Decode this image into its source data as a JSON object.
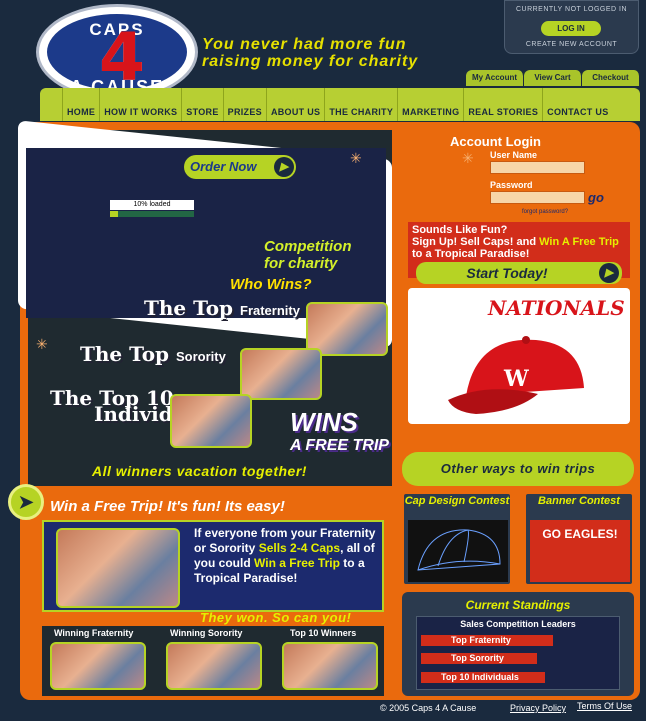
{
  "logo": {
    "top": "CAPS",
    "number": "4",
    "bottom": "A CAUSE"
  },
  "tagline": {
    "line1": "You never had more fun",
    "line2": "raising money for charity"
  },
  "login_box": {
    "status": "CURRENTLY NOT LOGGED IN",
    "button": "LOG IN",
    "create": "CREATE NEW ACCOUNT"
  },
  "utility": [
    "My Account",
    "View Cart",
    "Checkout"
  ],
  "nav": [
    "HOME",
    "HOW IT WORKS",
    "STORE",
    "PRIZES",
    "ABOUT US",
    "THE CHARITY",
    "MARKETING",
    "REAL STORIES",
    "CONTACT US"
  ],
  "flash": {
    "order_now": "Order Now",
    "loaded": "10% loaded",
    "loaded_fraction": 0.1
  },
  "competition": {
    "title_line1": "Competition",
    "title_line2": "for charity",
    "who_wins": "Who Wins?",
    "fraternity": {
      "prefix": "The Top",
      "word": "Fraternity"
    },
    "sorority": {
      "prefix": "The Top",
      "word": "Sorority"
    },
    "individuals": {
      "prefix": "The Top 10",
      "word": "Individuals"
    },
    "wins": "WINS",
    "free_trip": "A FREE TRIP",
    "all_winners": "All winners vacation together!"
  },
  "free_trip": {
    "heading": "Win a Free Trip! It's fun! Its easy!",
    "text_a": "If everyone from your Fraternity or Sorority",
    "text_hl1": "Sells 2-4 Caps",
    "text_b": ", all of you could",
    "text_hl2": "Win a Free Trip",
    "text_c": "to a Tropical Paradise!",
    "they_won": "They won. So can you!"
  },
  "winners": [
    "Winning Fraternity",
    "Winning Sorority",
    "Top 10 Winners"
  ],
  "account": {
    "title": "Account Login",
    "username_label": "User Name",
    "password_label": "Password",
    "go": "go",
    "forgot": "forgot password?"
  },
  "signup": {
    "line1": "Sounds Like Fun?",
    "line2a": "Sign Up! Sell Caps! and",
    "line2hl": "Win A Free Trip",
    "line2b": "to a Tropical Paradise!",
    "start": "Start Today!",
    "cap_brand": "NATIONALS"
  },
  "other_ways": "Other ways to win trips",
  "contests": {
    "cap_design": "Cap Design Contest",
    "banner": "Banner Contest",
    "banner_sign": "GO EAGLES!"
  },
  "standings": {
    "title": "Current Standings",
    "subtitle": "Sales Competition Leaders",
    "rows": [
      "Top Fraternity",
      "Top Sorority",
      "Top 10 Individuals"
    ]
  },
  "footer": {
    "copyright": "© 2005 Caps 4 A Cause",
    "privacy": "Privacy Policy",
    "terms": "Terms Of Use"
  },
  "colors": {
    "bg": "#1a2a3e",
    "orange": "#ea6a0d",
    "lime": "#b6d324",
    "yellow": "#e6f000",
    "red": "#d22d1a",
    "navy": "#1c2a6e"
  }
}
